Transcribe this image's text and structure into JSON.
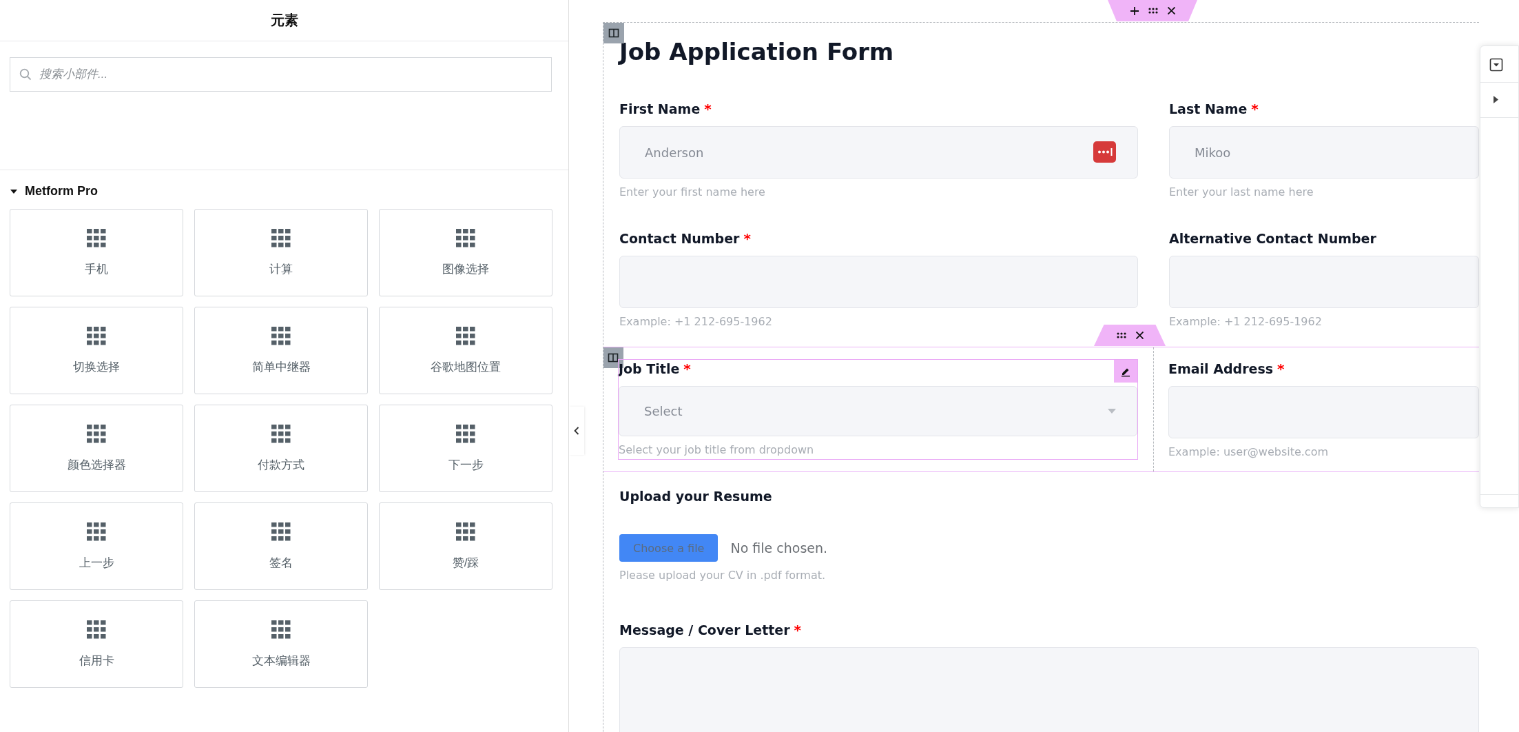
{
  "sidebar": {
    "title": "元素",
    "search": {
      "placeholder": "搜索小部件..."
    },
    "category": {
      "name": "Metform Pro",
      "expanded": true
    },
    "widgets": [
      {
        "label": "手机"
      },
      {
        "label": "计算"
      },
      {
        "label": "图像选择"
      },
      {
        "label": "切换选择"
      },
      {
        "label": "简单中继器"
      },
      {
        "label": "谷歌地图位置"
      },
      {
        "label": "颜色选择器"
      },
      {
        "label": "付款方式"
      },
      {
        "label": "下一步"
      },
      {
        "label": "上一步"
      },
      {
        "label": "签名"
      },
      {
        "label": "赞/踩"
      },
      {
        "label": "信用卡"
      },
      {
        "label": "文本编辑器"
      }
    ]
  },
  "form": {
    "title": "Job Application Form",
    "rows": [
      {
        "selected": false,
        "fields": [
          {
            "kind": "text",
            "label": "First Name",
            "required_mark": "*",
            "placeholder": "Anderson",
            "help": "Enter your first name here",
            "autofill_icon": true,
            "selected": false
          },
          {
            "kind": "text",
            "label": "Last Name",
            "required_mark": "*",
            "placeholder": "Mikoo",
            "help": "Enter your last name here",
            "selected": false
          }
        ]
      },
      {
        "selected": false,
        "fields": [
          {
            "kind": "text",
            "label": "Contact Number",
            "required_mark": "*",
            "help": "Example: +1 212-695-1962",
            "selected": false
          },
          {
            "kind": "text",
            "label": "Alternative Contact Number",
            "help": "Example: +1 212-695-1962",
            "selected": false
          }
        ]
      },
      {
        "selected": true,
        "fields": [
          {
            "kind": "select",
            "label": "Job Title",
            "required_mark": "*",
            "placeholder": "Select",
            "help": "Select your job title from dropdown",
            "selected": true
          },
          {
            "kind": "text",
            "label": "Email Address",
            "required_mark": "*",
            "help": "Example: user@website.com",
            "selected": false
          }
        ]
      },
      {
        "selected": false,
        "fields": [
          {
            "kind": "file",
            "label": "Upload your Resume",
            "button": "Choose a file",
            "status": "No file chosen.",
            "help": "Please upload your CV in .pdf format.",
            "selected": false
          }
        ]
      },
      {
        "selected": false,
        "fields": [
          {
            "kind": "textarea",
            "label": "Message / Cover Letter",
            "required_mark": "*",
            "selected": false
          }
        ]
      }
    ]
  }
}
